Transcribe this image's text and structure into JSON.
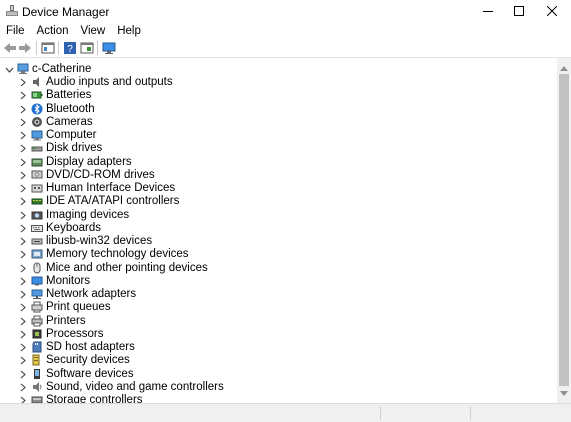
{
  "window": {
    "title": "Device Manager"
  },
  "menu": [
    "File",
    "Action",
    "View",
    "Help"
  ],
  "toolbar": {
    "buttons": [
      "back-arrow-icon",
      "forward-arrow-icon",
      "properties-icon",
      "help-icon",
      "update-driver-icon",
      "monitor-icon"
    ]
  },
  "tree": {
    "root": {
      "label": "c-Catherine",
      "icon": "computer-tree-icon"
    },
    "items": [
      {
        "label": "Audio inputs and outputs",
        "icon": "speaker-icon"
      },
      {
        "label": "Batteries",
        "icon": "battery-icon"
      },
      {
        "label": "Bluetooth",
        "icon": "bluetooth-icon"
      },
      {
        "label": "Cameras",
        "icon": "camera-icon"
      },
      {
        "label": "Computer",
        "icon": "computer-icon"
      },
      {
        "label": "Disk drives",
        "icon": "disk-drive-icon"
      },
      {
        "label": "Display adapters",
        "icon": "display-adapter-icon"
      },
      {
        "label": "DVD/CD-ROM drives",
        "icon": "dvd-drive-icon"
      },
      {
        "label": "Human Interface Devices",
        "icon": "hid-icon"
      },
      {
        "label": "IDE ATA/ATAPI controllers",
        "icon": "ide-controller-icon"
      },
      {
        "label": "Imaging devices",
        "icon": "imaging-device-icon"
      },
      {
        "label": "Keyboards",
        "icon": "keyboard-icon"
      },
      {
        "label": "libusb-win32 devices",
        "icon": "usb-device-icon"
      },
      {
        "label": "Memory technology devices",
        "icon": "memory-device-icon"
      },
      {
        "label": "Mice and other pointing devices",
        "icon": "mouse-icon"
      },
      {
        "label": "Monitors",
        "icon": "monitor-icon"
      },
      {
        "label": "Network adapters",
        "icon": "network-adapter-icon"
      },
      {
        "label": "Print queues",
        "icon": "print-queue-icon"
      },
      {
        "label": "Printers",
        "icon": "printer-icon"
      },
      {
        "label": "Processors",
        "icon": "processor-icon"
      },
      {
        "label": "SD host adapters",
        "icon": "sd-card-icon"
      },
      {
        "label": "Security devices",
        "icon": "security-device-icon"
      },
      {
        "label": "Software devices",
        "icon": "software-device-icon"
      },
      {
        "label": "Sound, video and game controllers",
        "icon": "sound-controller-icon"
      },
      {
        "label": "Storage controllers",
        "icon": "storage-controller-icon"
      }
    ]
  }
}
